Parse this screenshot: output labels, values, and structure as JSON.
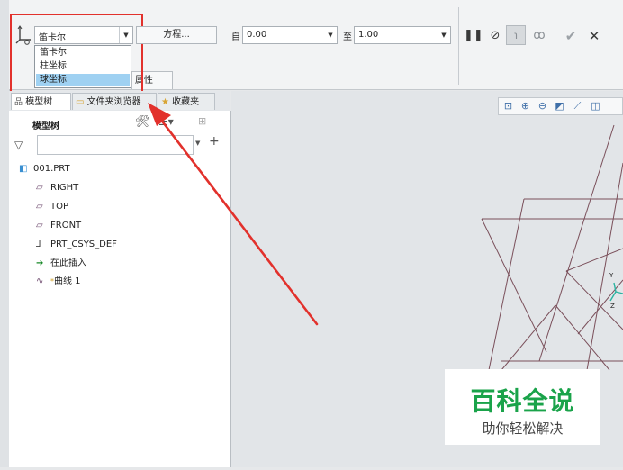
{
  "dashboard": {
    "coord_type_value": "笛卡尔",
    "coord_type_options": [
      "笛卡尔",
      "柱坐标",
      "球坐标"
    ],
    "equation_button": "方程...",
    "from_label": "自",
    "from_value": "0.00",
    "to_label": "至",
    "to_value": "1.00",
    "properties_label": "属性"
  },
  "tabs": [
    "模型树",
    "文件夹浏览器",
    "收藏夹"
  ],
  "tree": {
    "header": "模型树",
    "filter_placeholder": "",
    "items": [
      "001.PRT",
      "RIGHT",
      "TOP",
      "FRONT",
      "PRT_CSYS_DEF",
      "在此插入",
      "曲线 1"
    ]
  },
  "triad": {
    "y": "Y",
    "z": "Z"
  },
  "watermark": {
    "title": "百科全说",
    "subtitle": "助你轻松解决"
  },
  "colors": {
    "highlight": "#9fd1f2",
    "annotation_red": "#e2312c",
    "curve": "#7a4f5a",
    "watermark_green": "#1aa34a"
  }
}
